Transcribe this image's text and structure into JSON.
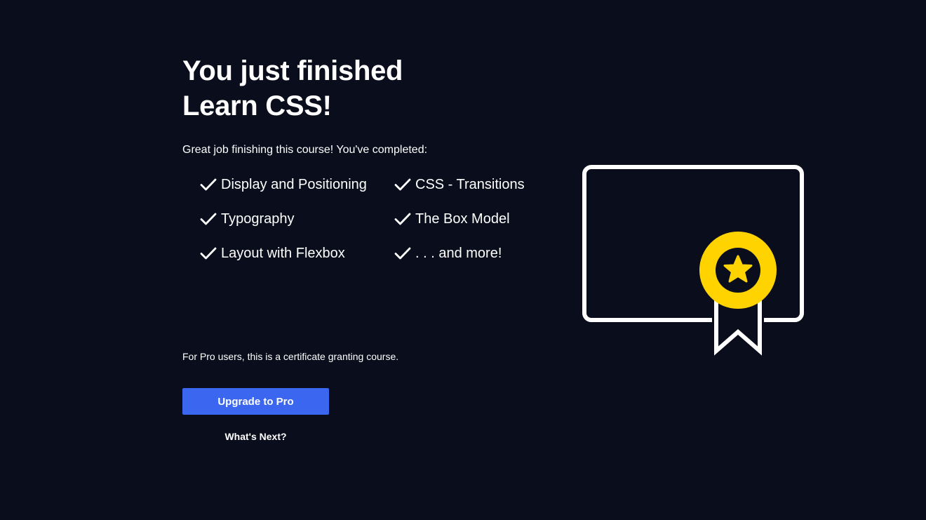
{
  "completion": {
    "headline_line1": "You just finished",
    "headline_line2": "Learn CSS!",
    "intro": "Great job finishing this course! You've completed:",
    "topics": [
      "Display and Positioning",
      "CSS - Transitions",
      "Typography",
      "The Box Model",
      "Layout with Flexbox",
      ". . . and more!"
    ],
    "pro_note": "For Pro users, this is a certificate granting course.",
    "upgrade_label": "Upgrade to Pro",
    "whats_next_label": "What's Next?"
  },
  "icons": {
    "topic_icon": "checkmark-icon",
    "illustration": "certificate-icon",
    "badge": "star-badge-icon"
  },
  "colors": {
    "background": "#0a0d1c",
    "primary_button": "#3a66f0",
    "badge": "#ffd300",
    "text": "#ffffff"
  }
}
